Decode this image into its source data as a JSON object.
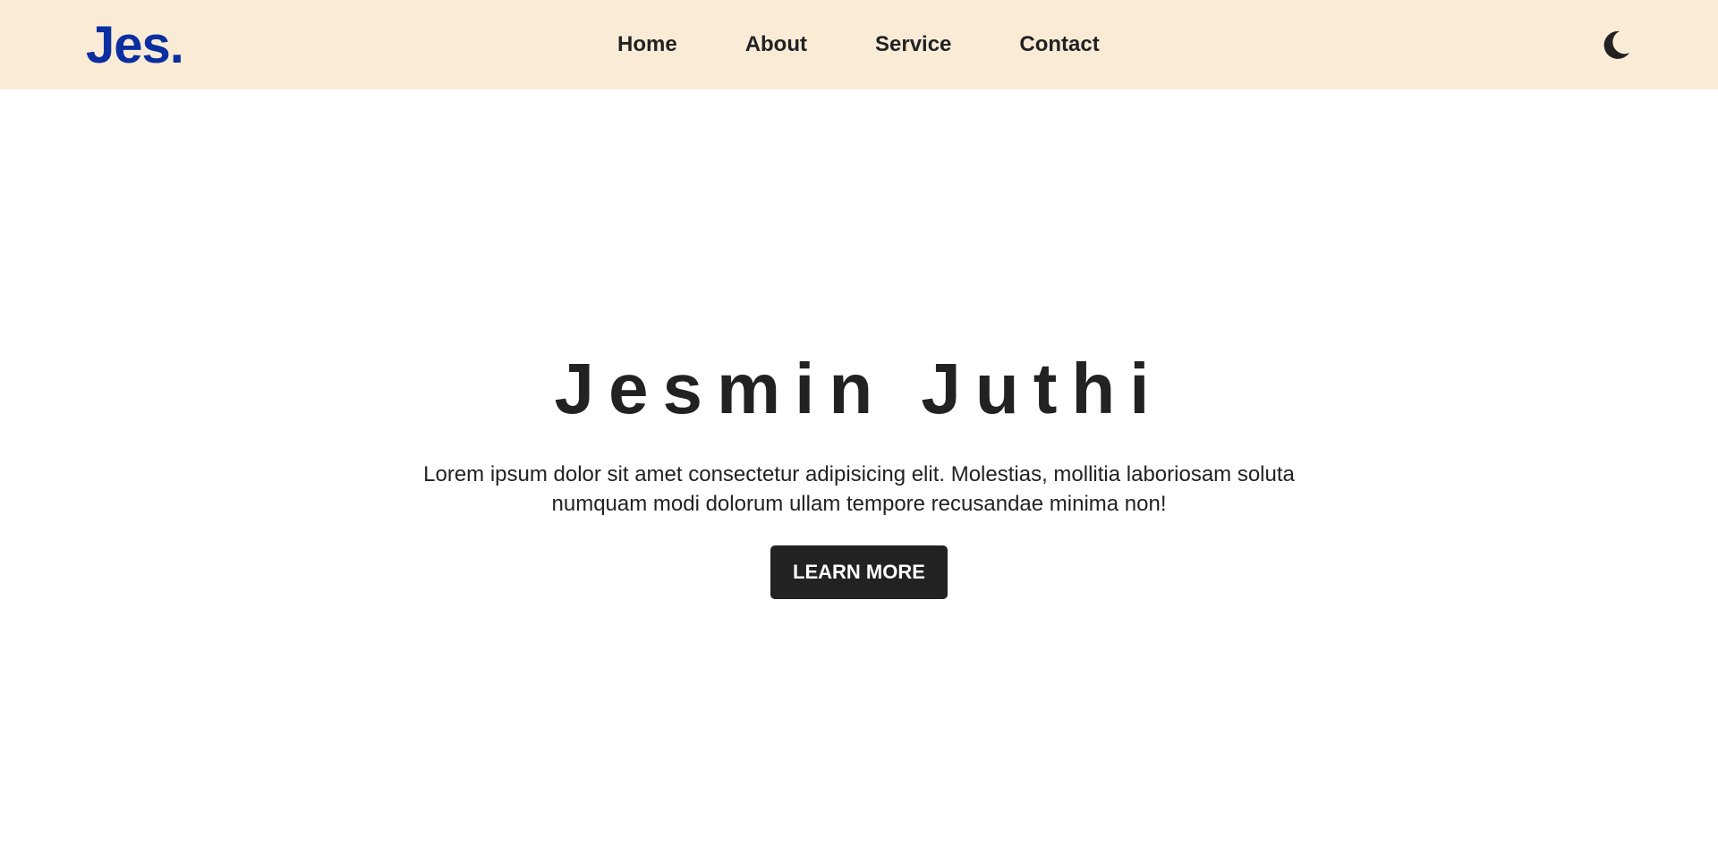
{
  "header": {
    "logo": "Jes.",
    "nav": [
      {
        "label": "Home"
      },
      {
        "label": "About"
      },
      {
        "label": "Service"
      },
      {
        "label": "Contact"
      }
    ],
    "theme_icon": "moon-icon"
  },
  "hero": {
    "title": "Jesmin Juthi",
    "text": "Lorem ipsum dolor sit amet consectetur adipisicing elit. Molestias, mollitia laboriosam soluta numquam modi dolorum ullam tempore recusandae minima non!",
    "button_label": "LEARN MORE"
  },
  "colors": {
    "header_bg": "#faebd7",
    "logo": "#0b2fa0",
    "text": "#222222",
    "button_bg": "#222222",
    "button_text": "#ffffff"
  }
}
